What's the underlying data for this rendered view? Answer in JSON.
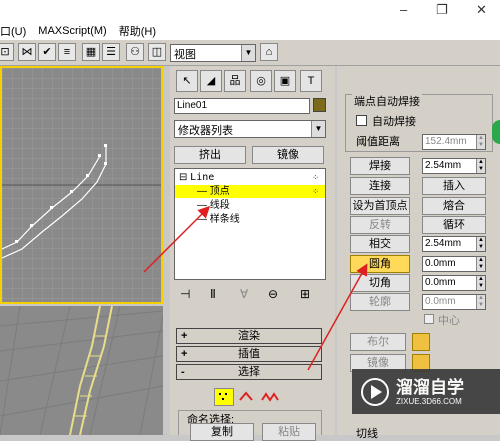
{
  "window": {
    "min": "–",
    "max": "❐",
    "close": "✕"
  },
  "menu": [
    "口(U)",
    "MAXScript(M)",
    "帮助(H)"
  ],
  "toolbar": {
    "view_label": "视图"
  },
  "modify_panel": {
    "object_name": "Line01",
    "modifier_list": "修改器列表",
    "extrude_label": "挤出",
    "mirror_label": "镜像",
    "stack": {
      "root": "Line",
      "items": [
        "顶点",
        "线段",
        "样条线"
      ],
      "expand_glyph": "⊟"
    },
    "rollouts": {
      "render": "渲染",
      "interp": "插值",
      "select": "选择"
    },
    "named_selection_label": "命名选择:",
    "copy_label": "复制",
    "paste_label": "粘贴"
  },
  "geometry": {
    "endpoint_weld_group": "端点自动焊接",
    "auto_weld_label": "自动焊接",
    "threshold_label": "阈值距离",
    "threshold_value": "152.4mm",
    "weld_label": "焊接",
    "weld_value": "2.54mm",
    "connect_label": "连接",
    "insert_label": "插入",
    "make_first_label": "设为首顶点",
    "fuse_label": "熔合",
    "reverse_label": "反转",
    "cycle_label": "循环",
    "crossinsert_label": "相交",
    "crossinsert_value": "2.54mm",
    "fillet_label": "圆角",
    "fillet_value": "0.0mm",
    "chamfer_label": "切角",
    "chamfer_value": "0.0mm",
    "outline_label": "轮廓",
    "outline_value": "0.0mm",
    "center_label": "中心",
    "boolean_label": "布尔",
    "mirror_label": "镜像",
    "trim_label": "切线"
  },
  "watermark": {
    "title": "溜溜自学",
    "url": "ZIXUE.3D66.COM"
  },
  "colors": {
    "highlight": "#ffff00",
    "viewport_border": "#f5d000",
    "arrow": "#e02020"
  }
}
